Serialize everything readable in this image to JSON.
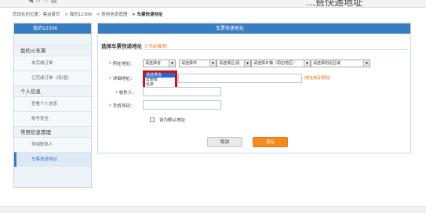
{
  "browser": {
    "title_fragment": "…费快递地址",
    "toolbar_icons": [
      "back-icon",
      "refresh-icon",
      "star-icon",
      "page-icon"
    ]
  },
  "breadcrumb": {
    "items": [
      "您现在的位置：客运首页",
      "> 我的12306",
      "> 常用信息管理",
      "> 车票快递地址"
    ]
  },
  "sidebar": {
    "header": "我的12306",
    "groups": [
      {
        "label": "我的火车票",
        "items": [
          "未完成订单",
          "已完成订单（改/退）"
        ]
      },
      {
        "label": "个人信息",
        "items": [
          "查看个人信息",
          "账号安全"
        ]
      },
      {
        "label": "常用信息管理",
        "items": [
          "常用联系人",
          "车票快递地址"
        ]
      }
    ],
    "active_item": "车票快递地址"
  },
  "main": {
    "header": "车票快递地址",
    "section_title": "选择车票快递地址",
    "section_hint": "（*为必填项）",
    "address_label": "所在地址：",
    "address_selects": [
      "请选择省",
      "请选择市",
      "请选择区/县",
      "请选择乡镇（周边地区）",
      "请选择附近区域"
    ],
    "dropdown_options": [
      "请选择省",
      "云南省",
      "北京"
    ],
    "dropdown_highlight_index": 0,
    "detail_label": "详细地址：",
    "detail_note": "(地址填写规则)",
    "recipient_label": "收件人：",
    "phone_label": "手机号码：",
    "default_checkbox_label": "设为默认地址",
    "cancel_label": "取消",
    "save_label": "保存"
  },
  "colors": {
    "accent": "#3a7cc2",
    "required": "#d0021b",
    "hint": "#e8630a",
    "save": "#f88b1f",
    "dropdown_border": "#d30f0f",
    "dropdown_highlight": "#1c6bd6"
  }
}
